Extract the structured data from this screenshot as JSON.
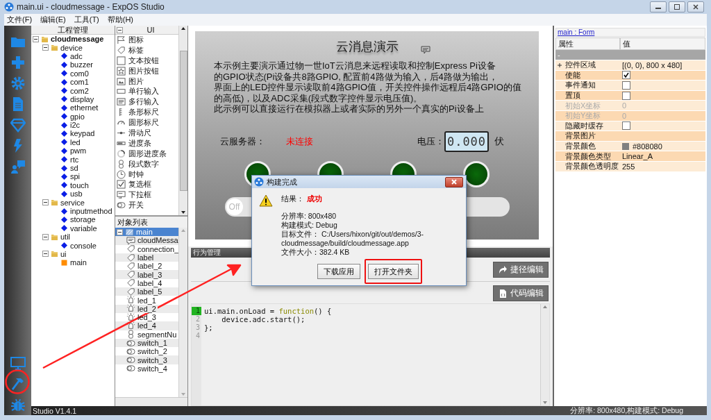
{
  "window": {
    "title": "main.ui - cloudmessage - ExpOS Studio"
  },
  "menu": [
    "文件(F)",
    "编辑(E)",
    "工具(T)",
    "帮助(H)"
  ],
  "project_tree": {
    "title": "工程管理",
    "items": [
      {
        "label": "cloudmessage",
        "kind": "project",
        "expanded": true,
        "children": [
          {
            "label": "device",
            "kind": "folder",
            "expanded": true,
            "children": [
              {
                "label": "adc",
                "kind": "module"
              },
              {
                "label": "buzzer",
                "kind": "module"
              },
              {
                "label": "com0",
                "kind": "module"
              },
              {
                "label": "com1",
                "kind": "module"
              },
              {
                "label": "com2",
                "kind": "module"
              },
              {
                "label": "display",
                "kind": "module"
              },
              {
                "label": "ethernet",
                "kind": "module"
              },
              {
                "label": "gpio",
                "kind": "module"
              },
              {
                "label": "i2c",
                "kind": "module"
              },
              {
                "label": "keypad",
                "kind": "module"
              },
              {
                "label": "led",
                "kind": "module"
              },
              {
                "label": "pwm",
                "kind": "module"
              },
              {
                "label": "rtc",
                "kind": "module"
              },
              {
                "label": "sd",
                "kind": "module"
              },
              {
                "label": "spi",
                "kind": "module"
              },
              {
                "label": "touch",
                "kind": "module"
              },
              {
                "label": "usb",
                "kind": "module"
              }
            ]
          },
          {
            "label": "service",
            "kind": "folder",
            "expanded": true,
            "children": [
              {
                "label": "inputmethod",
                "kind": "module"
              },
              {
                "label": "storage",
                "kind": "module"
              },
              {
                "label": "variable",
                "kind": "module"
              }
            ]
          },
          {
            "label": "util",
            "kind": "folder",
            "expanded": true,
            "children": [
              {
                "label": "console",
                "kind": "module"
              }
            ]
          },
          {
            "label": "ui",
            "kind": "folder",
            "expanded": true,
            "children": [
              {
                "label": "main",
                "kind": "page"
              }
            ]
          }
        ]
      }
    ]
  },
  "palette": {
    "title": "UI",
    "expanded": true,
    "items": [
      {
        "label": "图标",
        "kind": "flag"
      },
      {
        "label": "标签",
        "kind": "tag"
      },
      {
        "label": "文本按钮",
        "kind": "textbutton"
      },
      {
        "label": "图片按钮",
        "kind": "imagebutton"
      },
      {
        "label": "图片",
        "kind": "image"
      },
      {
        "label": "单行输入",
        "kind": "lineedit"
      },
      {
        "label": "多行输入",
        "kind": "textedit"
      },
      {
        "label": "条形标尺",
        "kind": "bargauge"
      },
      {
        "label": "圆形标尺",
        "kind": "gauge"
      },
      {
        "label": "滑动尺",
        "kind": "slider"
      },
      {
        "label": "进度条",
        "kind": "progress"
      },
      {
        "label": "圆形进度条",
        "kind": "ringprogress"
      },
      {
        "label": "段式数字",
        "kind": "segment"
      },
      {
        "label": "时钟",
        "kind": "clock"
      },
      {
        "label": "复选框",
        "kind": "checkbox"
      },
      {
        "label": "下拉框",
        "kind": "dropdown"
      },
      {
        "label": "开关",
        "kind": "switch"
      }
    ]
  },
  "object_list": {
    "title": "对象列表",
    "root": {
      "label": "main",
      "kind": "form",
      "selected": true,
      "expanded": true,
      "children": [
        {
          "label": "cloudMessa",
          "kind": "comment",
          "selected": false
        },
        {
          "label": "connection_",
          "kind": "tag",
          "selected": false
        },
        {
          "label": "label",
          "kind": "tag",
          "selected": false
        },
        {
          "label": "label_2",
          "kind": "tag",
          "selected": false
        },
        {
          "label": "label_3",
          "kind": "tag",
          "selected": false
        },
        {
          "label": "label_4",
          "kind": "tag",
          "selected": false
        },
        {
          "label": "label_5",
          "kind": "tag",
          "selected": false
        },
        {
          "label": "led_1",
          "kind": "led",
          "selected": false
        },
        {
          "label": "led_2",
          "kind": "led",
          "selected": false
        },
        {
          "label": "led_3",
          "kind": "led",
          "selected": false
        },
        {
          "label": "led_4",
          "kind": "led",
          "selected": false
        },
        {
          "label": "segmentNu",
          "kind": "segment",
          "selected": false
        },
        {
          "label": "switch_1",
          "kind": "switch",
          "selected": false
        },
        {
          "label": "switch_2",
          "kind": "switch",
          "selected": false
        },
        {
          "label": "switch_3",
          "kind": "switch",
          "selected": false
        },
        {
          "label": "switch_4",
          "kind": "switch",
          "selected": false
        }
      ]
    }
  },
  "canvas": {
    "title": "云消息演示",
    "description": [
      "本示例主要演示通过物一世IoT云消息来远程读取和控制Express Pi设备",
      "的GPIO状态(Pi设备共8路GPIO, 配置前4路做为输入，后4路做为输出，",
      "界面上的LED控件显示读取前4路GPIO值，开关控件操作远程后4路GPIO的值",
      "的高低)，以及ADC采集(段式数字控件显示电压值)。",
      "此示例可以直接运行在模拟器上或者实际的另外一个真实的Pi设备上"
    ],
    "server_label": "云服务器：",
    "server_status": "未连接",
    "voltage_label": "电压：",
    "voltage_value": "0.000",
    "voltage_unit": "伏",
    "leds": [
      {
        "on": false
      },
      {
        "on": false
      },
      {
        "on": false
      },
      {
        "on": false
      }
    ],
    "switches": [
      {
        "label": "Off",
        "on": false
      },
      {
        "on": false
      }
    ]
  },
  "behavior_panel": {
    "title": "行为管理",
    "shortcut_button": "捷径编辑",
    "code_button": "代码编辑",
    "code": [
      {
        "number": "1",
        "current": true,
        "tokens": [
          {
            "text": "ui.main.onLoad = ",
            "kind": "plain"
          },
          {
            "text": "function",
            "kind": "keyword"
          },
          {
            "text": "() {",
            "kind": "plain"
          }
        ]
      },
      {
        "number": "2",
        "current": false,
        "tokens": [
          {
            "text": "    device.adc.start();",
            "kind": "plain"
          }
        ]
      },
      {
        "number": "3",
        "current": false,
        "tokens": [
          {
            "text": "};",
            "kind": "plain"
          }
        ]
      },
      {
        "number": "4",
        "current": false
      }
    ]
  },
  "properties": {
    "object_link": "main : Form",
    "columns": [
      "属性",
      "值"
    ],
    "group": "-",
    "rows": [
      {
        "name": "控件区域",
        "kind": "text",
        "value": "[(0, 0), 800 x 480]",
        "expandable": true,
        "disabled": false
      },
      {
        "name": "使能",
        "kind": "check",
        "checked": true,
        "expandable": false,
        "disabled": false
      },
      {
        "name": "事件通知",
        "kind": "check",
        "checked": false,
        "expandable": false,
        "disabled": false
      },
      {
        "name": "置顶",
        "kind": "check",
        "checked": false,
        "expandable": false,
        "disabled": false
      },
      {
        "name": "初始X坐标",
        "kind": "text",
        "value": "0",
        "expandable": false,
        "disabled": true
      },
      {
        "name": "初始Y坐标",
        "kind": "text",
        "value": "0",
        "expandable": false,
        "disabled": true
      },
      {
        "name": "隐藏时缓存",
        "kind": "check",
        "checked": false,
        "expandable": false,
        "disabled": false
      },
      {
        "name": "背景图片",
        "kind": "text",
        "expandable": false,
        "disabled": false
      },
      {
        "name": "背景颜色",
        "kind": "color",
        "value": "#808080",
        "expandable": false,
        "disabled": false
      },
      {
        "name": "背景颜色类型",
        "kind": "text",
        "value": "Linear_A",
        "expandable": false,
        "disabled": false
      },
      {
        "name": "背景颜色透明度",
        "kind": "text",
        "value": "255",
        "expandable": false,
        "disabled": false
      }
    ]
  },
  "dialog": {
    "title": "构建完成",
    "result_label": "结果：",
    "result_value": "成功",
    "details": [
      "分辨率: 800x480",
      "构建模式: Debug",
      "目标文件： C:/Users/hixon/git/out/demos/3-cloudmessage/build/cloudmessage.app",
      "文件大小：382.4 KB"
    ],
    "buttons": [
      "下载应用",
      "打开文件夹"
    ]
  },
  "status_bar": {
    "version": "Studio V1.4.1",
    "info": "分辨率: 800x480,构建模式: Debug"
  }
}
